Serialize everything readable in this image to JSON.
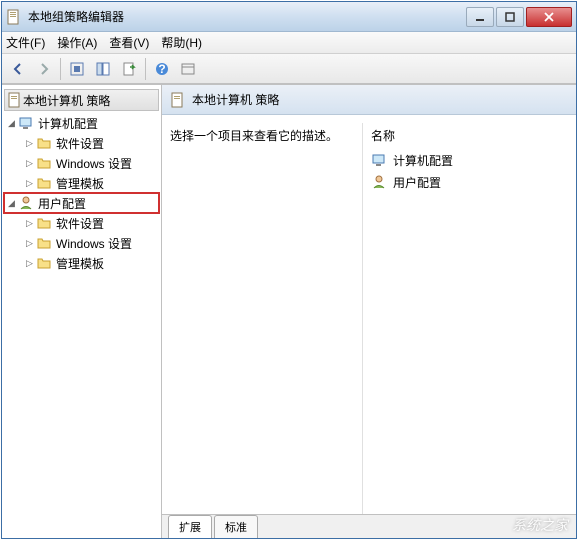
{
  "window": {
    "title": "本地组策略编辑器"
  },
  "menu": {
    "file": "文件(F)",
    "action": "操作(A)",
    "view": "查看(V)",
    "help": "帮助(H)"
  },
  "tree": {
    "root": "本地计算机 策略",
    "n1": "计算机配置",
    "n1a": "软件设置",
    "n1b": "Windows 设置",
    "n1c": "管理模板",
    "n2": "用户配置",
    "n2a": "软件设置",
    "n2b": "Windows 设置",
    "n2c": "管理模板"
  },
  "detail": {
    "title": "本地计算机 策略",
    "hint": "选择一个项目来查看它的描述。",
    "col_name": "名称",
    "item1": "计算机配置",
    "item2": "用户配置"
  },
  "tabs": {
    "ext": "扩展",
    "std": "标准"
  },
  "watermark": "系统之家"
}
